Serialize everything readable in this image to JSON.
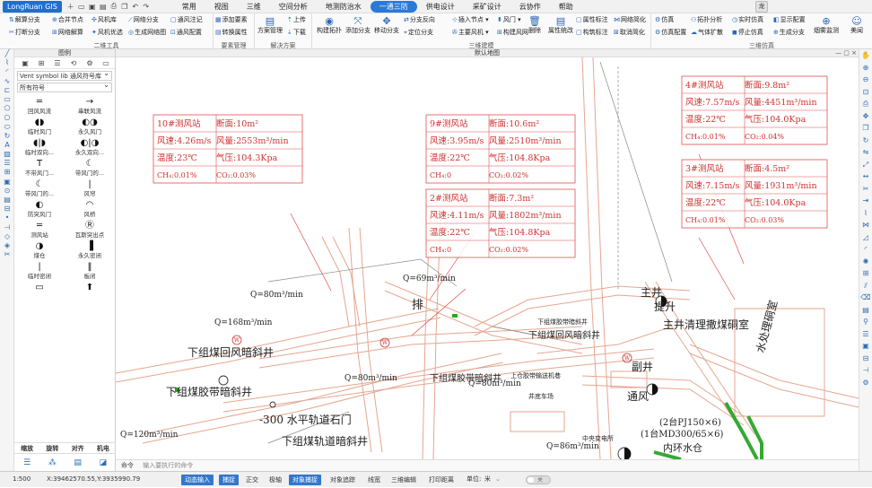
{
  "app": {
    "name": "LongRuan GIS",
    "avatar": "龙"
  },
  "menu": {
    "tabs": [
      "常用",
      "视图",
      "三维",
      "空间分析",
      "地测防治水",
      "一通三防",
      "供电设计",
      "采矿设计",
      "云协作",
      "帮助"
    ],
    "active": 5
  },
  "ribbon": {
    "g1": {
      "label": "二维工具",
      "items": [
        "解算分支",
        "合并节点",
        "风机库",
        "网络分支",
        "通风注记",
        "打断分支",
        "网络解算",
        "风机优选",
        "生成网络图",
        "通风配置"
      ]
    },
    "g2": {
      "label": "要素管理",
      "items": [
        "添加要素",
        "转换属性"
      ]
    },
    "g3": {
      "label": "解决方案",
      "items": [
        "方案管理",
        "上传",
        "下载"
      ]
    },
    "g4": {
      "label": "三维建模",
      "items": [
        "构建拓扑",
        "添加分支",
        "移动分支",
        "分支反向",
        "插入节点",
        "风门",
        "定位分支",
        "主要风机",
        "构建风网",
        "删除",
        "属性统改",
        "属性标注",
        "网络简化",
        "构筑标注",
        "取消简化"
      ]
    },
    "g5": {
      "label": "三维仿真",
      "items": [
        "仿真",
        "拓扑分析",
        "实时仿真",
        "显示配置",
        "仿真配置",
        "气体扩散",
        "停止仿真",
        "生成分支",
        "烟雾监测",
        "美闻"
      ]
    }
  },
  "legend": {
    "title": "图例",
    "library": "Vent symbol lib 通风符号库",
    "category": "所有符号",
    "symbols": [
      {
        "icon": "═",
        "name": "回风风流"
      },
      {
        "icon": "→",
        "name": "串联风流"
      },
      {
        "icon": "◖◗",
        "name": "临时风门"
      },
      {
        "icon": "◐◑",
        "name": "永久风门"
      },
      {
        "icon": "◖|◗",
        "name": "临时双向..."
      },
      {
        "icon": "◐|◑",
        "name": "永久双向..."
      },
      {
        "icon": "T",
        "name": "不带风门..."
      },
      {
        "icon": "☾",
        "name": "带风门的..."
      },
      {
        "icon": "☾",
        "name": "带风门的..."
      },
      {
        "icon": "|",
        "name": "风帘"
      },
      {
        "icon": "◐",
        "name": "防突风门"
      },
      {
        "icon": "◠",
        "name": "风桥"
      },
      {
        "icon": "═",
        "name": "测风站"
      },
      {
        "icon": "Ⓡ",
        "name": "瓦斯突出点"
      },
      {
        "icon": "◑",
        "name": "煤仓"
      },
      {
        "icon": "▐",
        "name": "永久密闭"
      },
      {
        "icon": "|",
        "name": "临时密闭"
      },
      {
        "icon": "‖",
        "name": "板闭"
      },
      {
        "icon": "▭",
        "name": ""
      },
      {
        "icon": "⬆",
        "name": ""
      }
    ],
    "footer": [
      "缩放",
      "旋转",
      "对齐",
      "机电"
    ]
  },
  "canvas": {
    "tab": "默认地图"
  },
  "command": {
    "label": "命令",
    "placeholder": "输入要执行的命令"
  },
  "status": {
    "scale": "1:500",
    "coords": "X:39462570.55,Y:3935990.79",
    "buttons": [
      "动态输入",
      "捕捉",
      "正交",
      "极轴",
      "对象捕捉",
      "对象追踪",
      "线宽",
      "三维编辑",
      "打印距离"
    ],
    "active": [
      0,
      1,
      4
    ],
    "unit_label": "单位:",
    "unit": "米",
    "toggle": "关"
  },
  "stations": [
    {
      "title": "10#测风站",
      "area": "断面:10m²",
      "speed": "风速:4.26m/s",
      "volume": "风量:2553m³/min",
      "temp": "温度:23℃",
      "pressure": "气压:104.3Kpa",
      "ch4": "CH₄:0.01%",
      "co2": "CO₂:0.03%"
    },
    {
      "title": "9#测风站",
      "area": "断面:10.6m²",
      "speed": "风速:3.95m/s",
      "volume": "风量:2510m³/min",
      "temp": "温度:22℃",
      "pressure": "气压:104.8Kpa",
      "ch4": "CH₄:0",
      "co2": "CO₂:0.02%"
    },
    {
      "title": "2#测风站",
      "area": "断面:7.3m²",
      "speed": "风速:4.11m/s",
      "volume": "风量:1802m³/min",
      "temp": "温度:22℃",
      "pressure": "气压:104.8Kpa",
      "ch4": "CH₄:0",
      "co2": "CO₂:0.02%"
    },
    {
      "title": "4#测风站",
      "area": "断面:9.8m²",
      "speed": "风速:7.57m/s",
      "volume": "风量:4451m³/min",
      "temp": "温度:22℃",
      "pressure": "气压:104.0Kpa",
      "ch4": "CH₄:0.01%",
      "co2": "CO₂:0.04%"
    },
    {
      "title": "3#测风站",
      "area": "断面:4.5m²",
      "speed": "风速:7.15m/s",
      "volume": "风量:1931m³/min",
      "temp": "温度:22℃",
      "pressure": "气压:104.0Kpa",
      "ch4": "CH₄:0.01%",
      "co2": "CO₂:0.03%"
    }
  ],
  "map_labels": {
    "q1": "Q=80m³/min",
    "q2": "Q=168m³/min",
    "q3": "Q=69m³/min",
    "q4": "Q=80m³/min",
    "q5": "Q=120m³/min",
    "q6": "Q=86m³/min",
    "q7": "Q=80m³/min",
    "l1": "下组煤回风暗斜井",
    "l2": "下组煤胶带暗斜井",
    "l3": "-300 水平轨道石门",
    "l4": "下组煤轨道暗斜井",
    "l5": "主井",
    "l6": "主井清理撒煤硐室",
    "l7": "副井",
    "l8": "水处理硐室",
    "l9": "下组煤回风暗斜井",
    "l10": "下组煤胶带暗斜井",
    "l11": "排",
    "l12": "(2台PJ150×6)",
    "l13": "(1台MD300/65×6)",
    "l14": "内环水仓",
    "l15": "通风",
    "l16": "上仓胶带输送机巷",
    "l17": "下组煤胶带暗斜井",
    "l18": "提升",
    "l19": "井底车场",
    "l20": "中央变电所"
  }
}
